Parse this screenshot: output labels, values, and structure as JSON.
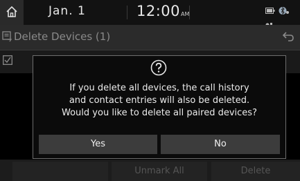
{
  "status_bar": {
    "date": "Jan. 1",
    "time": "12:00",
    "ampm": "AM"
  },
  "header": {
    "title": "Delete Devices (1)"
  },
  "dialog": {
    "message_lines": [
      "If you delete all devices, the call history",
      "and contact entries will also be deleted.",
      "Would you like to delete all paired devices?"
    ],
    "yes_label": "Yes",
    "no_label": "No"
  },
  "bottom_bar": {
    "mark_all_label": "",
    "unmark_all_label": "Unmark All",
    "delete_label": "Delete"
  }
}
